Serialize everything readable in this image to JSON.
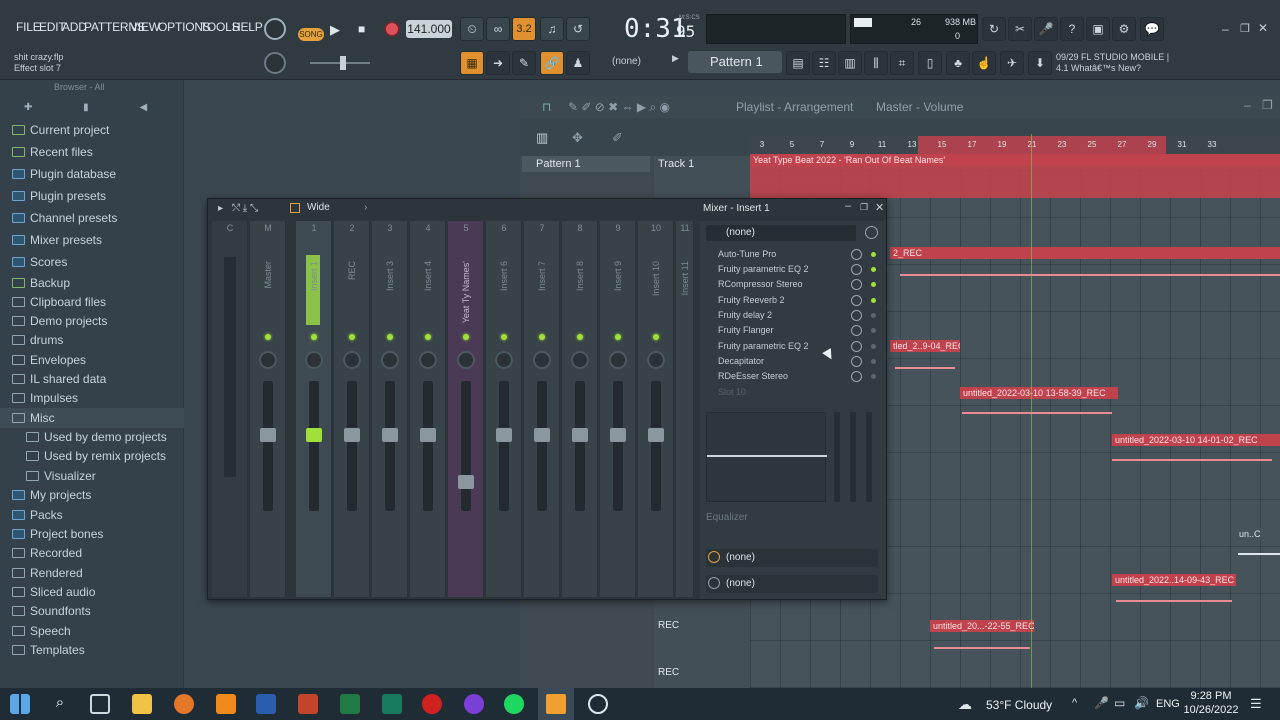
{
  "menu": [
    "FILE",
    "EDIT",
    "ADD",
    "PATTERNS",
    "VIEW",
    "OPTIONS",
    "TOOLS",
    "HELP"
  ],
  "project": {
    "file": "shit crazy.flp",
    "hint": "Effect slot 7"
  },
  "transport": {
    "song_label": "SONG",
    "tempo": "141.000",
    "time": "0:31",
    "time_frac": "95",
    "time_sub": "M:S:CS",
    "snap": "3.2"
  },
  "cpu": {
    "voices": "26",
    "memory": "938 MB",
    "zero": "0"
  },
  "pattern": {
    "none_label": "(none)",
    "name": "Pattern 1"
  },
  "news": {
    "date": "09/29",
    "line1": "FL STUDIO MOBILE |",
    "line2": "4.1 Whatâ€™s New?"
  },
  "browser": {
    "title": "Browser - All",
    "items": [
      {
        "label": "Current project"
      },
      {
        "label": "Recent files"
      },
      {
        "label": "Plugin database"
      },
      {
        "label": "Plugin presets"
      },
      {
        "label": "Channel presets"
      },
      {
        "label": "Mixer presets"
      },
      {
        "label": "Scores"
      },
      {
        "label": "Backup"
      },
      {
        "label": "Clipboard files"
      },
      {
        "label": "Demo projects"
      },
      {
        "label": "drums"
      },
      {
        "label": "Envelopes"
      },
      {
        "label": "IL shared data"
      },
      {
        "label": "Impulses"
      },
      {
        "label": "Misc"
      },
      {
        "label": "Used by demo projects"
      },
      {
        "label": "Used by remix projects"
      },
      {
        "label": "Visualizer"
      },
      {
        "label": "My projects"
      },
      {
        "label": "Packs"
      },
      {
        "label": "Project bones"
      },
      {
        "label": "Recorded"
      },
      {
        "label": "Rendered"
      },
      {
        "label": "Sliced audio"
      },
      {
        "label": "Soundfonts"
      },
      {
        "label": "Speech"
      },
      {
        "label": "Templates"
      }
    ]
  },
  "playlist": {
    "title": "Playlist - Arrangement",
    "breadcrumb": "Master - Volume",
    "pattern_item": "Pattern 1",
    "track1": "Track 1",
    "rec1": "REC",
    "rec2": "REC",
    "ruler": [
      "3",
      "5",
      "7",
      "9",
      "11",
      "13",
      "15",
      "17",
      "19",
      "21",
      "23",
      "25",
      "27",
      "29",
      "31",
      "33"
    ],
    "clips": [
      "Yeat Type Beat 2022 - 'Ran Out Of Beat Names'",
      "2_REC",
      "tled_2..9-04_REC",
      "untitled_2022-03-10 13-58-39_REC",
      "untitled_2022-03-10 14-01-02_REC",
      "un..C",
      "untitled_2022..14-09-43_REC",
      "untitled_20...-22-55_REC"
    ]
  },
  "mixer": {
    "title": "Mixer - Insert 1",
    "layout_label": "Wide",
    "strips": [
      {
        "num": "C",
        "name": ""
      },
      {
        "num": "M",
        "name": "Master"
      },
      {
        "num": "1",
        "name": "Insert 1"
      },
      {
        "num": "2",
        "name": "REC"
      },
      {
        "num": "3",
        "name": "Insert 3"
      },
      {
        "num": "4",
        "name": "Insert 4"
      },
      {
        "num": "5",
        "name": "Yeat Ty Names'"
      },
      {
        "num": "6",
        "name": "Insert 6"
      },
      {
        "num": "7",
        "name": "Insert 7"
      },
      {
        "num": "8",
        "name": "Insert 8"
      },
      {
        "num": "9",
        "name": "Insert 9"
      },
      {
        "num": "10",
        "name": "Insert 10"
      },
      {
        "num": "11",
        "name": "Insert 11"
      }
    ],
    "input": "(none)",
    "slots": [
      "Auto-Tune Pro",
      "Fruity parametric EQ 2",
      "RCompressor Stereo",
      "Fruity Reeverb 2",
      "Fruity delay 2",
      "Fruity Flanger",
      "Fruity parametric EQ 2",
      "Decapitator",
      "RDeEsser Stereo",
      "Slot 10"
    ],
    "eq_label": "Equalizer",
    "out1": "(none)",
    "out2": "(none)"
  },
  "taskbar": {
    "weather": "53°F  Cloudy",
    "lang": "ENG",
    "time": "9:28 PM",
    "date": "10/26/2022"
  }
}
